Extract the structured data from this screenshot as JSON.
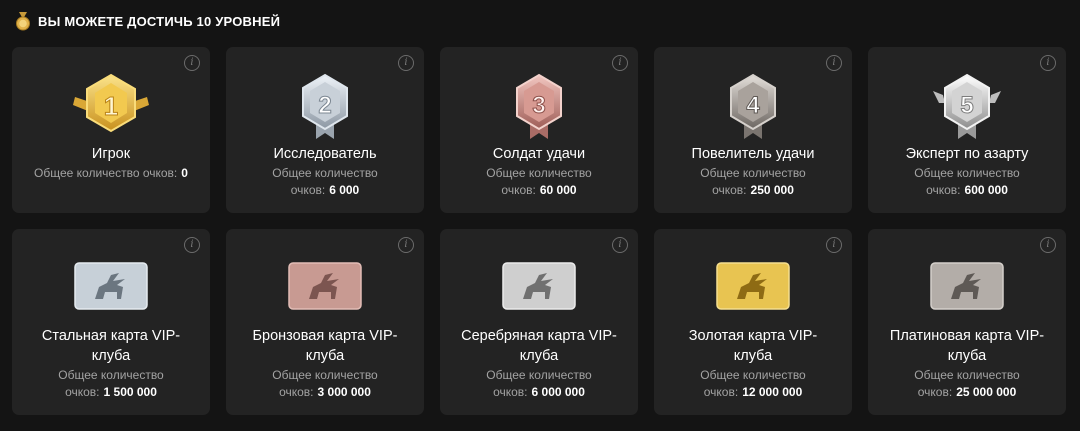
{
  "header": {
    "title": "ВЫ МОЖЕТЕ ДОСТИЧЬ 10 УРОВНЕЙ",
    "icon": "medal-icon"
  },
  "levels": [
    {
      "number": "1",
      "title": "Игрок",
      "points_label": "Общее количество очков:",
      "points": "0"
    },
    {
      "number": "2",
      "title": "Исследователь",
      "points_label_line1": "Общее количество",
      "points_label_line2": "очков:",
      "points": "6 000"
    },
    {
      "number": "3",
      "title": "Солдат удачи",
      "points_label_line1": "Общее количество",
      "points_label_line2": "очков:",
      "points": "60 000"
    },
    {
      "number": "4",
      "title": "Повелитель удачи",
      "points_label_line1": "Общее количество",
      "points_label_line2": "очков:",
      "points": "250 000"
    },
    {
      "number": "5",
      "title": "Эксперт по азарту",
      "points_label_line1": "Общее количество",
      "points_label_line2": "очков:",
      "points": "600 000"
    }
  ],
  "vip_cards": [
    {
      "title_line1": "Стальная карта VIP-",
      "title_line2": "клуба",
      "points_label_line1": "Общее количество",
      "points_label_line2": "очков:",
      "points": "1 500 000",
      "color": "#c7d0d8"
    },
    {
      "title_line1": "Бронзовая карта VIP-",
      "title_line2": "клуба",
      "points_label_line1": "Общее количество",
      "points_label_line2": "очков:",
      "points": "3 000 000",
      "color": "#c89a92"
    },
    {
      "title_line1": "Серебряная карта VIP-",
      "title_line2": "клуба",
      "points_label_line1": "Общее количество",
      "points_label_line2": "очков:",
      "points": "6 000 000",
      "color": "#cfcfcf"
    },
    {
      "title_line1": "Золотая карта VIP-",
      "title_line2": "клуба",
      "points_label_line1": "Общее количество",
      "points_label_line2": "очков:",
      "points": "12 000 000",
      "color": "#e8c451"
    },
    {
      "title_line1": "Платиновая карта VIP-",
      "title_line2": "клуба",
      "points_label_line1": "Общее количество",
      "points_label_line2": "очков:",
      "points": "25 000 000",
      "color": "#b3ada8"
    }
  ],
  "colors": {
    "background": "#141414",
    "card": "#232323",
    "gold": "#e6b93e",
    "silver": "#c3cbd3",
    "rose": "#c78b85",
    "steel": "#9a9590",
    "platinum": "#d9d9d9"
  }
}
